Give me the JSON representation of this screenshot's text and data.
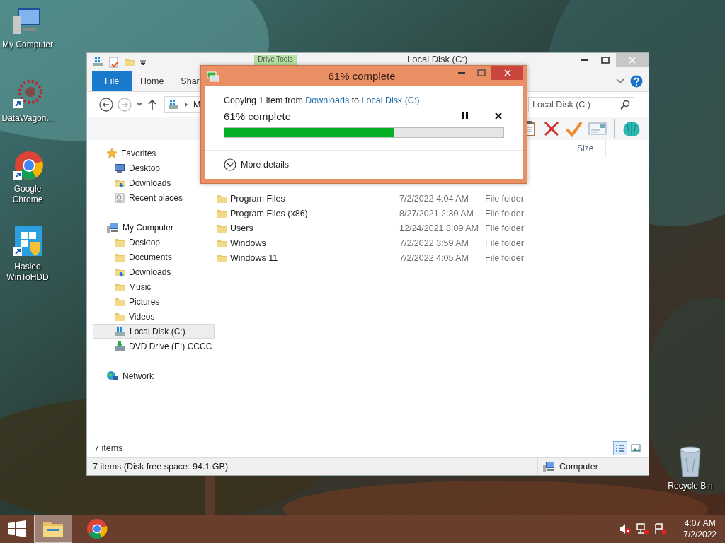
{
  "desktop": {
    "icons": [
      {
        "label": "My Computer",
        "kind": "computer"
      },
      {
        "label": "DataWagon...",
        "kind": "burst"
      },
      {
        "label": "Google Chrome",
        "kind": "chrome"
      },
      {
        "label": "Hasleo WinToHDD",
        "kind": "installer"
      }
    ],
    "recycle_bin": {
      "label": "Recycle Bin"
    }
  },
  "explorer": {
    "title": "Local Disk (C:)",
    "contextual_tab": "Drive Tools",
    "ribbon_tabs": [
      {
        "label": "File",
        "kind": "file"
      },
      {
        "label": "Home",
        "kind": "tab"
      },
      {
        "label": "Shar",
        "kind": "tab"
      }
    ],
    "address": {
      "crumb": "M"
    },
    "search": {
      "placeholder": "Local Disk (C:)"
    },
    "columns": [
      "Size"
    ],
    "navigation": [
      {
        "label": "Favorites",
        "selected": false,
        "children": [
          {
            "label": "Desktop",
            "selected": false
          },
          {
            "label": "Downloads",
            "selected": false
          },
          {
            "label": "Recent places",
            "selected": false
          }
        ]
      },
      {
        "label": "My Computer",
        "selected": false,
        "children": [
          {
            "label": "Desktop",
            "selected": false
          },
          {
            "label": "Documents",
            "selected": false
          },
          {
            "label": "Downloads",
            "selected": false
          },
          {
            "label": "Music",
            "selected": false
          },
          {
            "label": "Pictures",
            "selected": false
          },
          {
            "label": "Videos",
            "selected": false
          },
          {
            "label": "Local Disk (C:)",
            "selected": true
          },
          {
            "label": "DVD Drive (E:) CCCC",
            "selected": false
          }
        ]
      },
      {
        "label": "Network",
        "selected": false
      }
    ],
    "files": [
      {
        "name": "Program Files",
        "date": "7/2/2022 4:04 AM",
        "type": "File folder"
      },
      {
        "name": "Program Files (x86)",
        "date": "8/27/2021 2:30 AM",
        "type": "File folder"
      },
      {
        "name": "Users",
        "date": "12/24/2021 8:09 AM",
        "type": "File folder"
      },
      {
        "name": "Windows",
        "date": "7/2/2022 3:59 AM",
        "type": "File folder"
      },
      {
        "name": "Windows 11",
        "date": "7/2/2022 4:05 AM",
        "type": "File folder"
      }
    ],
    "item_count": "7 items",
    "views": [
      {
        "kind": "details",
        "selected": true
      },
      {
        "kind": "large",
        "selected": false
      }
    ],
    "status_bar": {
      "text": "7 items (Disk free space: 94.1 GB)",
      "location": "Computer"
    }
  },
  "dialog": {
    "title": "61% complete",
    "prefix": "Copying 1 item from",
    "source": "Downloads",
    "middle": "to",
    "destination": "Local Disk (C:)",
    "status": "61% complete",
    "level": 0.61,
    "more_details": "More details",
    "expanded": false
  },
  "taskbar": {
    "items": [
      {
        "kind": "start",
        "active": false
      },
      {
        "kind": "explorer",
        "active": true
      },
      {
        "kind": "chrome",
        "active": false
      }
    ],
    "time": "4:07 AM",
    "date": "7/2/2022"
  }
}
